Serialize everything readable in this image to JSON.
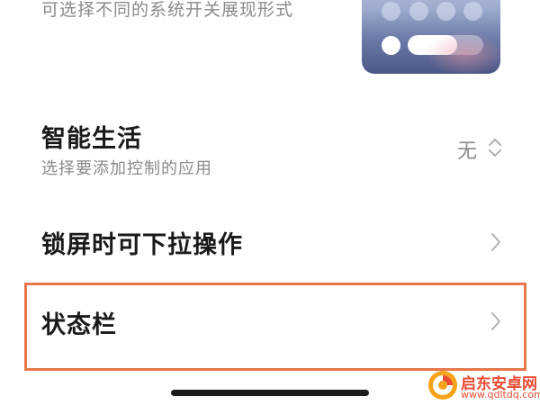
{
  "system_display": {
    "description": "可选择不同的系统开关展现形式",
    "preview_icon": "control-center-preview-icon",
    "preview_slider_level": 0.66
  },
  "smart_life": {
    "title": "智能生活",
    "subtitle": "选择要添加控制的应用",
    "value": "无",
    "icon": "up-down-chevron-icon"
  },
  "lockscreen_pulldown": {
    "title": "锁屏时可下拉操作",
    "icon": "chevron-right-icon"
  },
  "status_bar": {
    "title": "状态栏",
    "icon": "chevron-right-icon",
    "highlight_color": "#e8764a"
  },
  "watermark": {
    "name": "启东安卓网",
    "url": "www.qdltdq.com",
    "color": "#e94b32"
  },
  "colors": {
    "title": "#1a1a1a",
    "secondary": "#8a8a8a",
    "chevron": "#b0b0b0"
  }
}
